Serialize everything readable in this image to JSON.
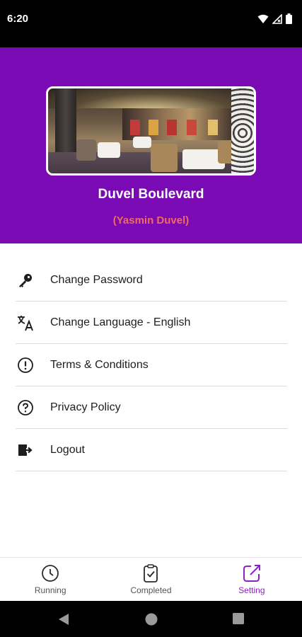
{
  "status_bar": {
    "time": "6:20"
  },
  "profile": {
    "restaurant_name": "Duvel Boulevard",
    "owner_name": "(Yasmin Duvel)"
  },
  "menu": {
    "items": [
      {
        "label": "Change Password",
        "icon": "key-icon"
      },
      {
        "label": "Change Language - English",
        "icon": "translate-icon"
      },
      {
        "label": "Terms & Conditions",
        "icon": "info-circle-icon"
      },
      {
        "label": "Privacy Policy",
        "icon": "help-circle-icon"
      },
      {
        "label": "Logout",
        "icon": "logout-icon"
      }
    ]
  },
  "bottom_nav": {
    "tabs": [
      {
        "label": "Running",
        "icon": "clock-icon",
        "active": false
      },
      {
        "label": "Completed",
        "icon": "clipboard-check-icon",
        "active": false
      },
      {
        "label": "Setting",
        "icon": "share-edit-icon",
        "active": true
      }
    ]
  },
  "colors": {
    "header_bg": "#7a0ab4",
    "accent": "#8b22c8",
    "owner_name": "#f06b5d"
  }
}
